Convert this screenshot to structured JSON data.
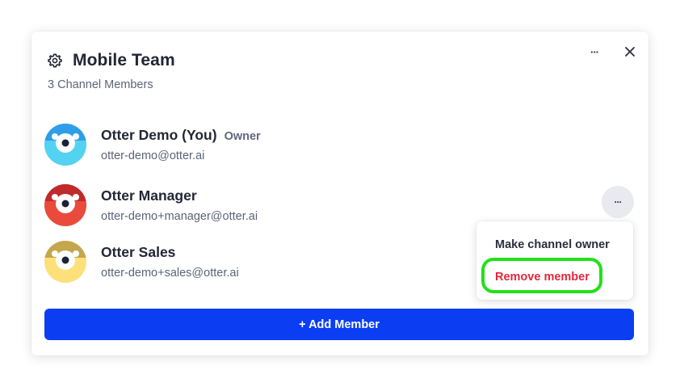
{
  "dialog": {
    "title": "Mobile Team",
    "subtitle": "3 Channel Members",
    "more_label": "···",
    "close_label": "✕"
  },
  "members": [
    {
      "name": "Otter Demo (You)",
      "badge": "Owner",
      "email": "otter-demo@otter.ai",
      "avatar_color": "#2f9de8",
      "avatar_color_light": "#53d2f2"
    },
    {
      "name": "Otter Manager",
      "email": "otter-demo+manager@otter.ai",
      "avatar_color": "#c02a2a",
      "avatar_color_light": "#ea4a3c"
    },
    {
      "name": "Otter Sales",
      "email": "otter-demo+sales@otter.ai",
      "avatar_color": "#c4a64e",
      "avatar_color_light": "#fde07a"
    }
  ],
  "row_menu": {
    "trigger_label": "···",
    "items": [
      {
        "label": "Make channel owner",
        "color": "#2a2e3e"
      },
      {
        "label": "Remove member",
        "color": "#e0283d"
      }
    ]
  },
  "add_button": {
    "label": "+ Add Member",
    "color": "#0b3ef2"
  },
  "highlight_color": "#22e01a",
  "icons": {
    "settings": "gear-icon",
    "more": "more-horizontal-icon",
    "close": "close-icon"
  }
}
